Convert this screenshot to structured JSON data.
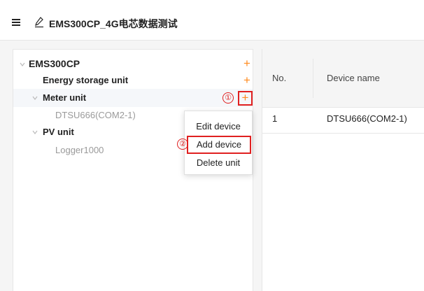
{
  "header": {
    "title": "EMS300CP_4G电芯数据测试"
  },
  "tree": {
    "root": {
      "label": "EMS300CP",
      "add": "+"
    },
    "energy_storage": {
      "label": "Energy storage unit",
      "add": "+"
    },
    "meter": {
      "label": "Meter unit",
      "add": "+",
      "step": "①"
    },
    "meter_device": {
      "label": "DTSU666(COM2-1)"
    },
    "pv": {
      "label": "PV unit"
    },
    "pv_device": {
      "label": "Logger1000"
    }
  },
  "context_menu": {
    "step": "②",
    "items": [
      "Edit device",
      "Add device",
      "Delete unit"
    ]
  },
  "table": {
    "columns": [
      "No.",
      "Device name"
    ],
    "rows": [
      {
        "no": "1",
        "name": "DTSU666(COM2-1)"
      }
    ]
  },
  "colors": {
    "accent_orange": "#ff8a1e",
    "highlight_red": "#e02020"
  }
}
